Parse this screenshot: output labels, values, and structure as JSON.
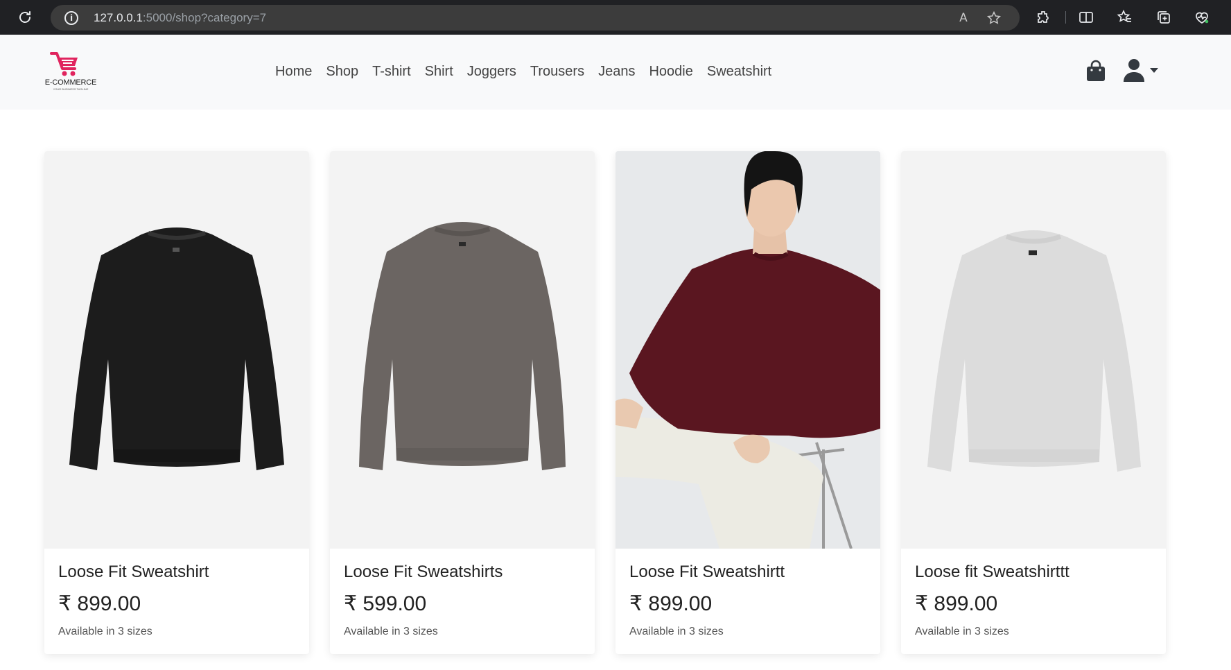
{
  "browser": {
    "url_host": "127.0.0.1",
    "url_rest": ":5000/shop?category=7"
  },
  "site": {
    "logo_text": "E-COMMERCE",
    "logo_tagline": "YOUR BUSINESS TAGLINE",
    "nav": [
      "Home",
      "Shop",
      "T-shirt",
      "Shirt",
      "Joggers",
      "Trousers",
      "Jeans",
      "Hoodie",
      "Sweatshirt"
    ]
  },
  "colors": {
    "brand": "#e0245e",
    "nav_bg": "#f8f9fa",
    "black_garment": "#1c1c1c",
    "grey_garment": "#6b6562",
    "maroon_garment": "#5a1620",
    "lightgrey_garment": "#dcdcdc"
  },
  "products": [
    {
      "name": "Loose Fit Sweatshirt",
      "price": "₹ 899.00",
      "availability": "Available in 3 sizes",
      "image": "black-sweatshirt"
    },
    {
      "name": "Loose Fit Sweatshirts",
      "price": "₹ 599.00",
      "availability": "Available in 3 sizes",
      "image": "grey-sweatshirt"
    },
    {
      "name": "Loose Fit Sweatshirtt",
      "price": "₹ 899.00",
      "availability": "Available in 3 sizes",
      "image": "model-maroon-sweatshirt"
    },
    {
      "name": "Loose fit Sweatshirttt",
      "price": "₹ 899.00",
      "availability": "Available in 3 sizes",
      "image": "lightgrey-sweatshirt"
    }
  ]
}
